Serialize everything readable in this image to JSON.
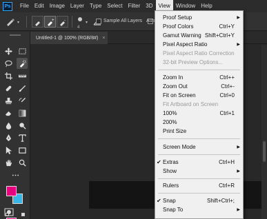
{
  "app": {
    "logo": "Ps"
  },
  "menubar": {
    "items": [
      {
        "label": "File"
      },
      {
        "label": "Edit"
      },
      {
        "label": "Image"
      },
      {
        "label": "Layer"
      },
      {
        "label": "Type"
      },
      {
        "label": "Select"
      },
      {
        "label": "Filter"
      },
      {
        "label": "3D"
      },
      {
        "label": "View"
      },
      {
        "label": "Window"
      },
      {
        "label": "Help"
      }
    ]
  },
  "options": {
    "brush_size": "4",
    "sample_all_layers": "Sample All Layers",
    "auto_label": "Auto"
  },
  "document": {
    "tab_title": "Untitled-1 @ 100% (RGB/8#)",
    "close": "×"
  },
  "colors": {
    "foreground": "#e6007e",
    "background": "#3ab6e6",
    "accent": "#31a8ff"
  },
  "view_menu": {
    "proof_setup": "Proof Setup",
    "proof_colors": "Proof Colors",
    "proof_colors_sc": "Ctrl+Y",
    "gamut_warning": "Gamut Warning",
    "gamut_warning_sc": "Shift+Ctrl+Y",
    "pixel_aspect_ratio": "Pixel Aspect Ratio",
    "pixel_aspect_correction": "Pixel Aspect Ratio Correction",
    "preview_32bit": "32-bit Preview Options...",
    "zoom_in": "Zoom In",
    "zoom_in_sc": "Ctrl++",
    "zoom_out": "Zoom Out",
    "zoom_out_sc": "Ctrl+-",
    "fit_on_screen": "Fit on Screen",
    "fit_on_screen_sc": "Ctrl+0",
    "fit_artboard": "Fit Artboard on Screen",
    "zoom_100": "100%",
    "zoom_100_sc": "Ctrl+1",
    "zoom_200": "200%",
    "print_size": "Print Size",
    "screen_mode": "Screen Mode",
    "extras": "Extras",
    "extras_sc": "Ctrl+H",
    "show": "Show",
    "rulers": "Rulers",
    "rulers_sc": "Ctrl+R",
    "snap": "Snap",
    "snap_sc": "Shift+Ctrl+;",
    "snap_to": "Snap To",
    "check": "✔",
    "arrow": "▶"
  }
}
